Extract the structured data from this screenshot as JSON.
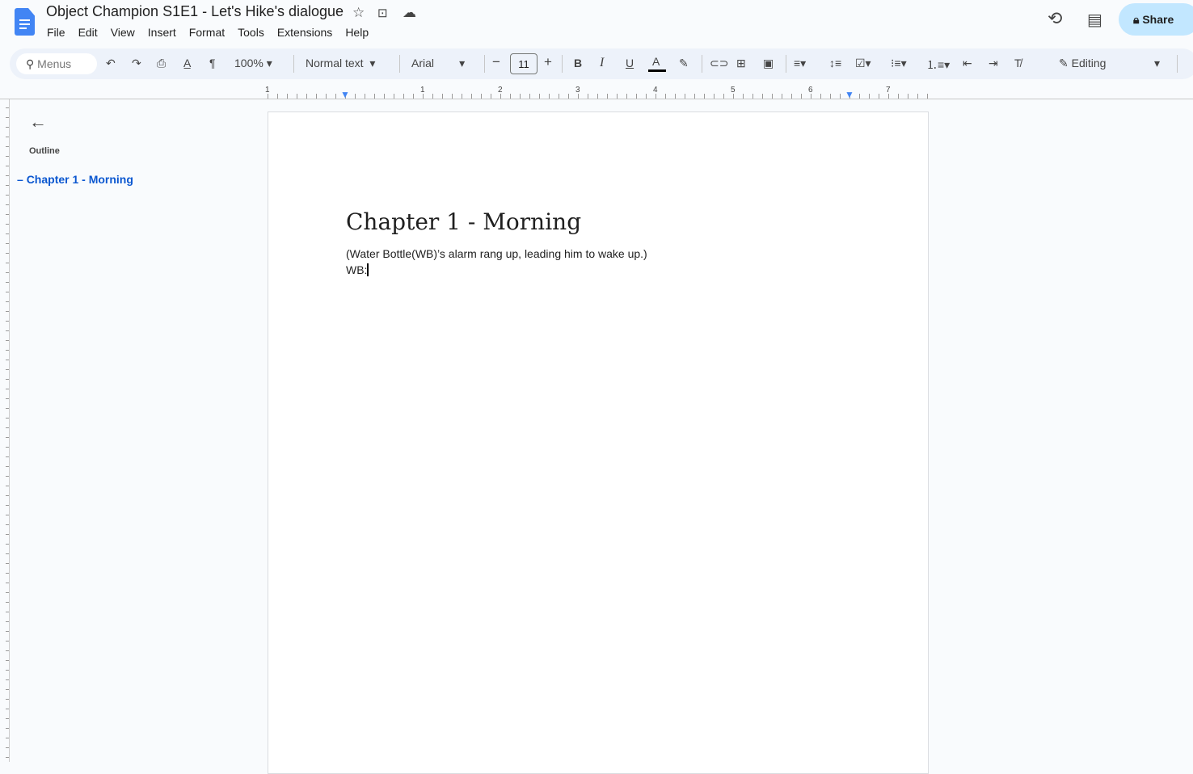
{
  "doc": {
    "title": "Object Champion S1E1 - Let's Hike's dialogue"
  },
  "menu": [
    "File",
    "Edit",
    "View",
    "Insert",
    "Format",
    "Tools",
    "Extensions",
    "Help"
  ],
  "toolbar": {
    "search_placeholder": "Menus",
    "zoom": "100%",
    "style": "Normal text",
    "font": "Arial",
    "font_size": "11",
    "mode": "Editing",
    "minus": "−",
    "plus": "+",
    "bold": "B",
    "italic": "I",
    "underline": "U",
    "text_color": "A"
  },
  "share": {
    "label": "Share"
  },
  "ruler": [
    "1",
    "1",
    "2",
    "3",
    "4",
    "5",
    "6",
    "7"
  ],
  "outline": {
    "label": "Outline",
    "items": [
      "Chapter 1 - Morning"
    ]
  },
  "content": {
    "heading": "Chapter 1 - Morning",
    "line1": "(Water Bottle(WB)’s alarm rang up, leading him to wake up.)",
    "line2": "WB:"
  },
  "colors": {
    "accent": "#0b57d0",
    "share_bg": "#c2e7ff",
    "toolbar_bg": "#edf2fa"
  }
}
